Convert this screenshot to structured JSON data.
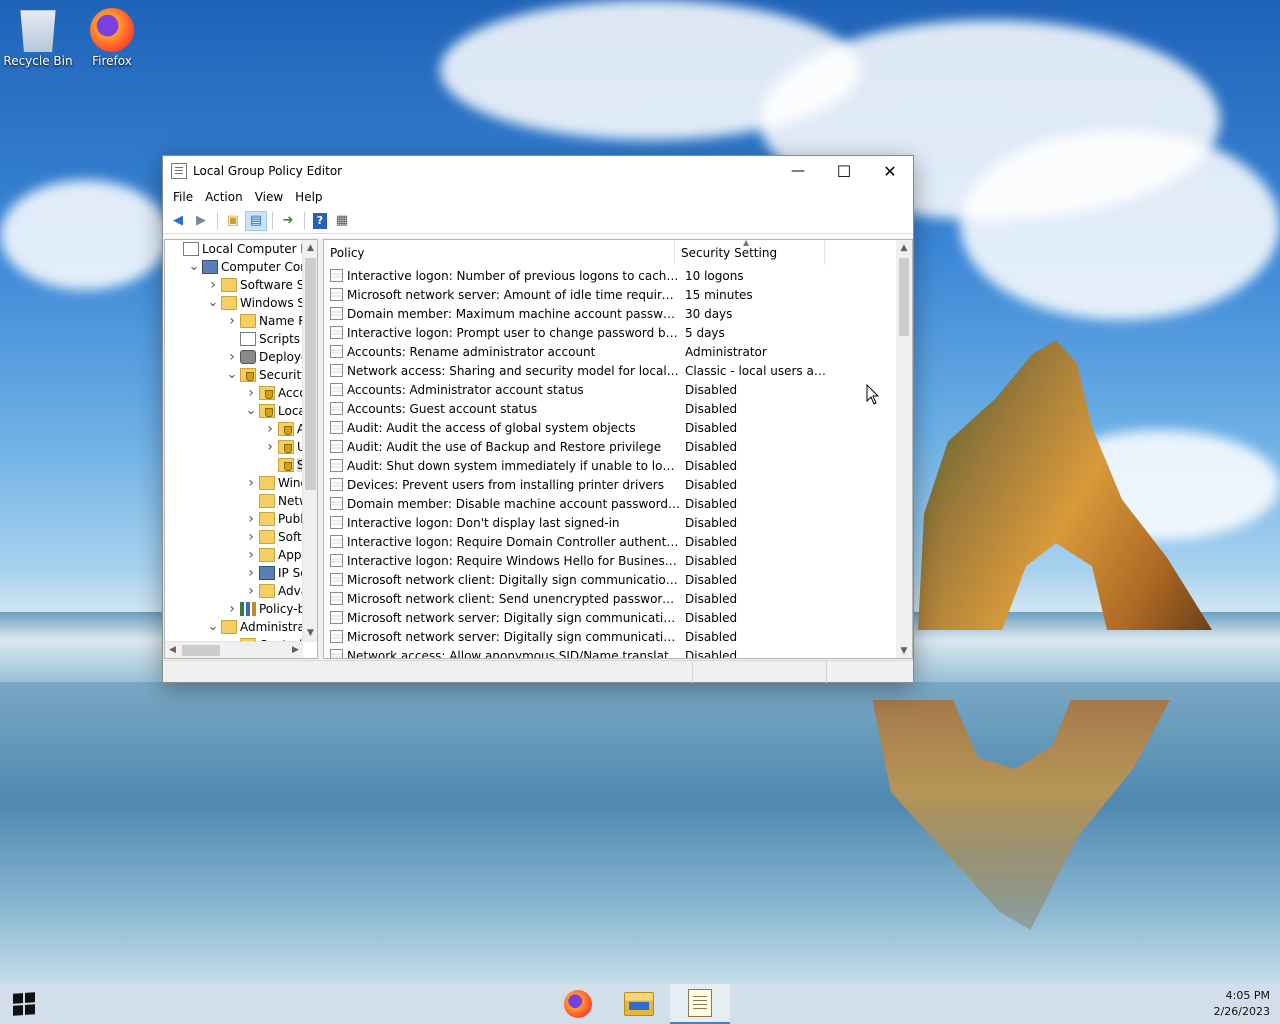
{
  "desktop": {
    "icons": [
      {
        "label": "Recycle Bin",
        "icon": "recycle-bin-icon"
      },
      {
        "label": "Firefox",
        "icon": "firefox-icon"
      }
    ]
  },
  "window": {
    "title": "Local Group Policy Editor",
    "controls": {
      "minimize": "—",
      "maximize": "☐",
      "close": "✕"
    },
    "menu": [
      "File",
      "Action",
      "View",
      "Help"
    ],
    "toolbar": [
      "back-icon",
      "forward-icon",
      "up-folder-icon",
      "show-hide-tree-icon",
      "export-list-icon",
      "help-icon",
      "properties-icon"
    ]
  },
  "tree": [
    {
      "label": "Local Computer Polic",
      "indent": 0,
      "chevron": "",
      "icon": "doc"
    },
    {
      "label": "Computer Config",
      "indent": 1,
      "chevron": "open",
      "icon": "computer"
    },
    {
      "label": "Software Setti",
      "indent": 2,
      "chevron": "closed",
      "icon": "folder"
    },
    {
      "label": "Windows Sett",
      "indent": 2,
      "chevron": "open",
      "icon": "folder"
    },
    {
      "label": "Name Res",
      "indent": 3,
      "chevron": "closed",
      "icon": "folder"
    },
    {
      "label": "Scripts (St",
      "indent": 3,
      "chevron": "",
      "icon": "doc"
    },
    {
      "label": "Deployed",
      "indent": 3,
      "chevron": "closed",
      "icon": "gear"
    },
    {
      "label": "Security Se",
      "indent": 3,
      "chevron": "open",
      "icon": "shield"
    },
    {
      "label": "Accou",
      "indent": 4,
      "chevron": "closed",
      "icon": "shield"
    },
    {
      "label": "Local P",
      "indent": 4,
      "chevron": "open",
      "icon": "shield"
    },
    {
      "label": "Au",
      "indent": 5,
      "chevron": "closed",
      "icon": "shield"
    },
    {
      "label": "Use",
      "indent": 5,
      "chevron": "closed",
      "icon": "shield"
    },
    {
      "label": "Sec",
      "indent": 5,
      "chevron": "",
      "icon": "shield",
      "selected": true
    },
    {
      "label": "Windo",
      "indent": 4,
      "chevron": "closed",
      "icon": "folder"
    },
    {
      "label": "Netwo",
      "indent": 4,
      "chevron": "",
      "icon": "folder"
    },
    {
      "label": "Public",
      "indent": 4,
      "chevron": "closed",
      "icon": "folder"
    },
    {
      "label": "Softwa",
      "indent": 4,
      "chevron": "closed",
      "icon": "folder"
    },
    {
      "label": "Applic",
      "indent": 4,
      "chevron": "closed",
      "icon": "folder"
    },
    {
      "label": "IP Secu",
      "indent": 4,
      "chevron": "closed",
      "icon": "computer"
    },
    {
      "label": "Advan",
      "indent": 4,
      "chevron": "closed",
      "icon": "folder"
    },
    {
      "label": "Policy-bas",
      "indent": 3,
      "chevron": "closed",
      "icon": "chart"
    },
    {
      "label": "Administrativ",
      "indent": 2,
      "chevron": "open",
      "icon": "folder"
    },
    {
      "label": "Control P",
      "indent": 3,
      "chevron": "closed",
      "icon": "folder"
    }
  ],
  "list": {
    "columns": {
      "policy": "Policy",
      "setting": "Security Setting"
    },
    "rows": [
      {
        "policy": "Interactive logon: Number of previous logons to cache (in c...",
        "setting": "10 logons"
      },
      {
        "policy": "Microsoft network server: Amount of idle time required bef...",
        "setting": "15 minutes"
      },
      {
        "policy": "Domain member: Maximum machine account password age",
        "setting": "30 days"
      },
      {
        "policy": "Interactive logon: Prompt user to change password before e...",
        "setting": "5 days"
      },
      {
        "policy": "Accounts: Rename administrator account",
        "setting": "Administrator"
      },
      {
        "policy": "Network access: Sharing and security model for local accou...",
        "setting": "Classic - local users auth..."
      },
      {
        "policy": "Accounts: Administrator account status",
        "setting": "Disabled"
      },
      {
        "policy": "Accounts: Guest account status",
        "setting": "Disabled"
      },
      {
        "policy": "Audit: Audit the access of global system objects",
        "setting": "Disabled"
      },
      {
        "policy": "Audit: Audit the use of Backup and Restore privilege",
        "setting": "Disabled"
      },
      {
        "policy": "Audit: Shut down system immediately if unable to log secur...",
        "setting": "Disabled"
      },
      {
        "policy": "Devices: Prevent users from installing printer drivers",
        "setting": "Disabled"
      },
      {
        "policy": "Domain member: Disable machine account password chan...",
        "setting": "Disabled"
      },
      {
        "policy": "Interactive logon: Don't display last signed-in",
        "setting": "Disabled"
      },
      {
        "policy": "Interactive logon: Require Domain Controller authentication...",
        "setting": "Disabled"
      },
      {
        "policy": "Interactive logon: Require Windows Hello for Business or sm...",
        "setting": "Disabled"
      },
      {
        "policy": "Microsoft network client: Digitally sign communications (al...",
        "setting": "Disabled"
      },
      {
        "policy": "Microsoft network client: Send unencrypted password to thi...",
        "setting": "Disabled"
      },
      {
        "policy": "Microsoft network server: Digitally sign communications (al...",
        "setting": "Disabled"
      },
      {
        "policy": "Microsoft network server: Digitally sign communications (if ...",
        "setting": "Disabled"
      },
      {
        "policy": "Network access: Allow anonymous SID/Name translation",
        "setting": "Disabled"
      }
    ]
  },
  "taskbar": {
    "apps": [
      "firefox-icon",
      "file-explorer-icon",
      "group-policy-editor-icon"
    ],
    "time": "4:05 PM",
    "date": "2/26/2023"
  }
}
